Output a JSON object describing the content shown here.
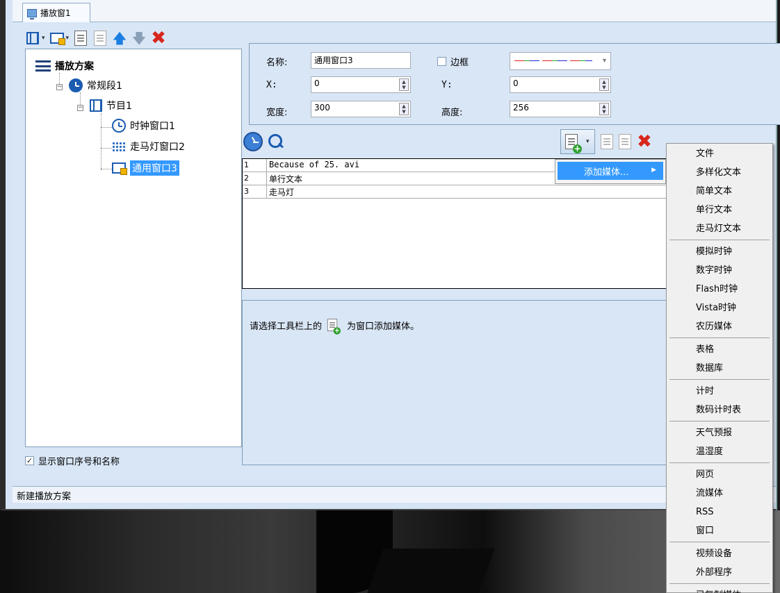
{
  "tab": {
    "title": "播放窗1"
  },
  "tree": {
    "root": "播放方案",
    "segment": "常规段1",
    "program": "节目1",
    "windows": [
      "时钟窗口1",
      "走马灯窗口2",
      "通用窗口3"
    ],
    "selected_index": 2
  },
  "show_window_checkbox": {
    "label": "显示窗口序号和名称",
    "checked": true
  },
  "properties": {
    "name_label": "名称:",
    "name_value": "通用窗口3",
    "border_label": "边框",
    "border_checked": false,
    "x_label": "X:",
    "x_value": "0",
    "y_label": "Y:",
    "y_value": "0",
    "width_label": "宽度:",
    "width_value": "300",
    "height_label": "高度:",
    "height_value": "256"
  },
  "media_list": [
    {
      "num": "1",
      "name": "Because of 25. avi"
    },
    {
      "num": "2",
      "name": "单行文本"
    },
    {
      "num": "3",
      "name": "走马灯"
    }
  ],
  "info": {
    "text_before": "请选择工具栏上的",
    "text_after": "为窗口添加媒体。"
  },
  "status": {
    "text": "新建播放方案"
  },
  "submenu": {
    "label": "添加媒体..."
  },
  "context_menu": {
    "groups": [
      [
        "文件",
        "多样化文本",
        "简单文本",
        "单行文本",
        "走马灯文本"
      ],
      [
        "模拟时钟",
        "数字时钟",
        "Flash时钟",
        "Vista时钟",
        "农历媒体"
      ],
      [
        "表格",
        "数据库"
      ],
      [
        "计时",
        "数码计时表"
      ],
      [
        "天气预报",
        "温湿度"
      ],
      [
        "网页",
        "流媒体",
        "RSS",
        "窗口"
      ],
      [
        "视频设备",
        "外部程序"
      ],
      [
        "已复制媒体"
      ]
    ]
  },
  "colors": {
    "accent": "#3399ff",
    "icon_blue": "#1b5cb0",
    "delete_red": "#d9261c",
    "panel_bg": "#d9e6f6"
  }
}
